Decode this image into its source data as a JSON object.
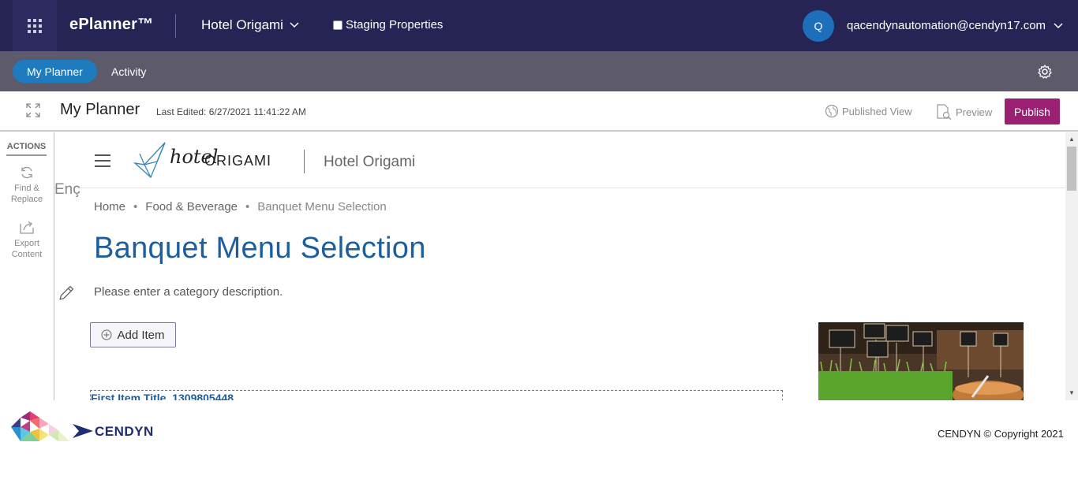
{
  "topbar": {
    "brand": "ePlanner™",
    "hotel_select": "Hotel Origami",
    "staging_label": "Staging Properties",
    "avatar_initial": "Q",
    "user_email": "qacendynautomation@cendyn17.com"
  },
  "subnav": {
    "tabs": [
      {
        "label": "My Planner",
        "active": true
      },
      {
        "label": "Activity",
        "active": false
      }
    ]
  },
  "toolbar": {
    "title": "My Planner",
    "last_edited": "Last Edited: 6/27/2021 11:41:22 AM",
    "published_view": "Published View",
    "preview": "Preview",
    "publish": "Publish"
  },
  "actions": {
    "title": "ACTIONS",
    "items": [
      {
        "label_line1": "Find &",
        "label_line2": "Replace",
        "icon": "refresh-icon"
      },
      {
        "label_line1": "Export",
        "label_line2": "Content",
        "icon": "export-icon"
      }
    ]
  },
  "site": {
    "logo_text_1": "hotel",
    "logo_text_2": "ORIGAMI",
    "hotel_name": "Hotel Origami",
    "fragment_text": "Enç",
    "breadcrumb": [
      "Home",
      "Food & Beverage",
      "Banquet Menu Selection"
    ],
    "breadcrumb_separator": "•",
    "page_title": "Banquet Menu Selection",
    "category_description": "Please enter a category description.",
    "add_item": "Add Item",
    "first_item_title": "First Item Title_1309805448"
  },
  "footer": {
    "logo_text": "CENDYN",
    "copyright": "CENDYN © Copyright 2021"
  },
  "colors": {
    "topbar": "#262355",
    "subnav": "#5d5a6b",
    "accent_blue": "#1e7bbd",
    "publish": "#9b1f73",
    "title_blue": "#1c5fa0"
  }
}
